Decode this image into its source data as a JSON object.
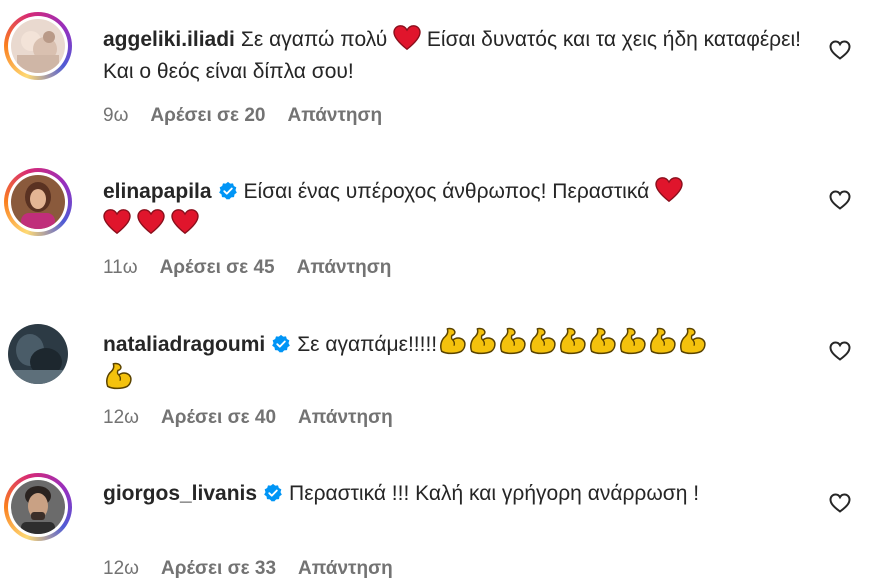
{
  "comments": [
    {
      "username": "aggeliki.iliadi",
      "verified": false,
      "text_a": "Σε αγαπώ πολύ",
      "text_b": " Είσαι δυνατός και τα χεις ήδη καταφέρει!Και ο θεός είναι δίπλα σου!",
      "time": "9ω",
      "likes": "Αρέσει σε 20",
      "reply": "Απάντηση"
    },
    {
      "username": "elinapapila",
      "verified": true,
      "text_a": "Είσαι ένας υπέροχος άνθρωπος! Περαστικά",
      "text_b": "",
      "time": "11ω",
      "likes": "Αρέσει σε 45",
      "reply": "Απάντηση"
    },
    {
      "username": "nataliadragoumi",
      "verified": true,
      "text_a": "Σε αγαπάμε!!!!!",
      "text_b": "",
      "time": "12ω",
      "likes": "Αρέσει σε 40",
      "reply": "Απάντηση"
    },
    {
      "username": "giorgos_livanis",
      "verified": true,
      "text_a": "Περαστικά !!! Καλή και γρήγορη ανάρρωση !",
      "text_b": "",
      "time": "12ω",
      "likes": "Αρέσει σε 33",
      "reply": "Απάντηση"
    }
  ],
  "colors": {
    "text": "#262626",
    "meta": "#737373",
    "verified": "#0095f6",
    "heart_emoji": "#e0152c",
    "flex_emoji": "#f4c20d"
  },
  "icons": {
    "like": "heart-outline-icon",
    "verified": "verified-badge-icon",
    "red_heart": "red-heart-emoji",
    "flexed_biceps": "flexed-biceps-emoji"
  }
}
